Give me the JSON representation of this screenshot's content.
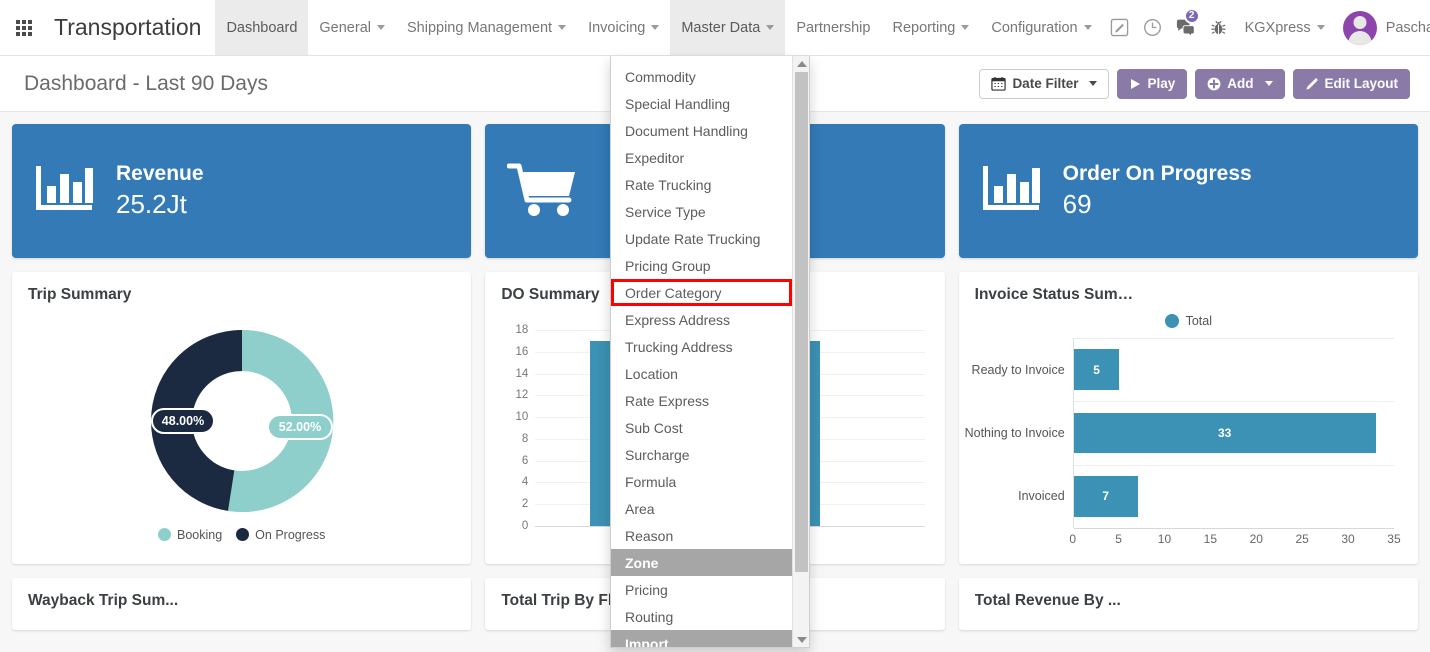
{
  "navbar": {
    "apps_icon": "grid-apps-icon",
    "brand": "Transportation",
    "menu": [
      {
        "label": "Dashboard",
        "has_caret": false,
        "active": true
      },
      {
        "label": "General",
        "has_caret": true,
        "active": false
      },
      {
        "label": "Shipping Management",
        "has_caret": true,
        "active": false
      },
      {
        "label": "Invoicing",
        "has_caret": true,
        "active": false
      },
      {
        "label": "Master Data",
        "has_caret": true,
        "active": true
      },
      {
        "label": "Partnership",
        "has_caret": false,
        "active": false
      },
      {
        "label": "Reporting",
        "has_caret": true,
        "active": false
      },
      {
        "label": "Configuration",
        "has_caret": true,
        "active": false
      }
    ],
    "icons": [
      {
        "name": "edit-square-icon"
      },
      {
        "name": "clock-icon"
      },
      {
        "name": "chat-bubbles-icon",
        "badge": "2"
      },
      {
        "name": "bug-icon"
      }
    ],
    "database": "KGXpress",
    "username": "Paschalis (odoodev",
    "badge_color": "#7b68b5"
  },
  "page_header": {
    "title": "Dashboard - Last 90 Days",
    "date_filter": "Date Filter",
    "play": "Play",
    "add": "Add",
    "edit_layout": "Edit Layout",
    "purple": "#8a7aa8"
  },
  "kpis": [
    {
      "label": "Revenue",
      "value": "25.2Jt",
      "icon": "bar-chart-icon"
    },
    {
      "label": "",
      "value": "",
      "icon": "shopping-cart-icon"
    },
    {
      "label": "Order On Progress",
      "value": "69",
      "icon": "bar-chart-icon"
    }
  ],
  "cards": {
    "trip_summary": "Trip Summary",
    "do_summary": "DO Summary",
    "invoice_status": "Invoice Status Sum…",
    "wayback": "Wayback Trip Sum...",
    "total_trip_fleet": "Total Trip By Fleet ...",
    "total_revenue": "Total Revenue By ..."
  },
  "dropdown": {
    "parent": "Master Data",
    "items": [
      {
        "label": "Commodity"
      },
      {
        "label": "Special Handling"
      },
      {
        "label": "Document Handling"
      },
      {
        "label": "Expeditor"
      },
      {
        "label": "Rate Trucking"
      },
      {
        "label": "Service Type"
      },
      {
        "label": "Update Rate Trucking"
      },
      {
        "label": "Pricing Group"
      },
      {
        "label": "Order Category",
        "highlighted": true
      },
      {
        "label": "Express Address"
      },
      {
        "label": "Trucking Address"
      },
      {
        "label": "Location"
      },
      {
        "label": "Rate Express"
      },
      {
        "label": "Sub Cost"
      },
      {
        "label": "Surcharge"
      },
      {
        "label": "Formula"
      },
      {
        "label": "Area"
      },
      {
        "label": "Reason"
      },
      {
        "label": "Zone",
        "hover": true
      },
      {
        "label": "Pricing"
      },
      {
        "label": "Routing"
      },
      {
        "label": "Import",
        "hover": true
      }
    ],
    "highlight_color": "#ff0000",
    "hover_color": "#a6a6a6"
  },
  "chart_data": [
    {
      "type": "pie",
      "title": "Trip Summary",
      "labels": [
        "Booking",
        "On Progress"
      ],
      "values": [
        52.0,
        48.0
      ],
      "value_labels": [
        "52.00%",
        "48.00%"
      ],
      "colors": [
        "#8ecfcc",
        "#1b2a41"
      ],
      "legend": "bottom",
      "donut": true
    },
    {
      "type": "bar",
      "title": "DO Summary",
      "categories": [
        "",
        ""
      ],
      "values": [
        17,
        17
      ],
      "ylim": [
        0,
        18
      ],
      "yticks": [
        0,
        2,
        4,
        6,
        8,
        10,
        12,
        14,
        16,
        18
      ],
      "xlabel": "",
      "ylabel": "",
      "colors": [
        "#3c92b4"
      ],
      "grid": true,
      "note": "partially occluded by open dropdown menu"
    },
    {
      "type": "bar",
      "orientation": "horizontal",
      "title": "Invoice Status Sum…",
      "categories": [
        "Ready to Invoice",
        "Nothing to Invoice",
        "Invoiced"
      ],
      "values": [
        5,
        33,
        7
      ],
      "series": [
        {
          "name": "Total",
          "values": [
            5,
            33,
            7
          ]
        }
      ],
      "xlim": [
        0,
        35
      ],
      "xticks": [
        0,
        5,
        10,
        15,
        20,
        25,
        30,
        35
      ],
      "colors": [
        "#3c92b4"
      ],
      "legend": "top",
      "grid": true
    }
  ]
}
